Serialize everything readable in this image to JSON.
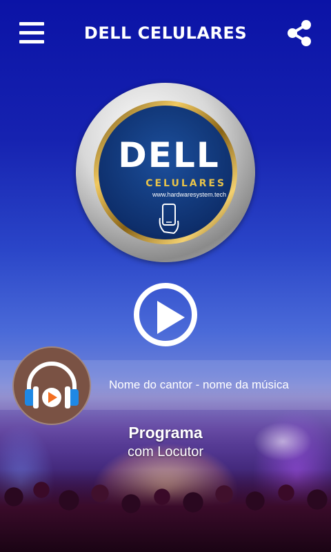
{
  "header": {
    "title": "DELL CELULARES",
    "menu_icon": "hamburger-menu-icon",
    "share_icon": "share-icon"
  },
  "logo": {
    "brand": "DELL",
    "subtitle": "CELULARES",
    "url": "www.hardwaresystem.tech",
    "icon": "smartphone-hand-icon"
  },
  "player": {
    "play_icon": "play-icon",
    "song": "Nome do cantor - nome da música",
    "cover_icon": "headphones-play-icon",
    "program": "Programa",
    "host": "com Locutor"
  },
  "colors": {
    "background_top": "#0b13a6",
    "accent_gold": "#e8c34a",
    "cover_bg": "#7a5244",
    "headphone_blue": "#1e88e5",
    "play_orange": "#f36f21"
  }
}
